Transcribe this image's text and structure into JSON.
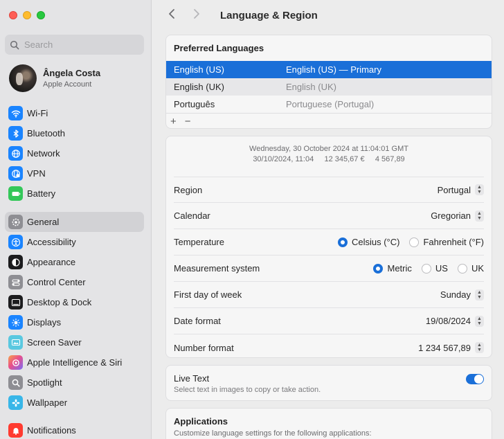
{
  "window": {
    "title": "Language & Region"
  },
  "sidebar": {
    "search_placeholder": "Search",
    "account": {
      "name": "Ângela Costa",
      "subtitle": "Apple Account"
    },
    "group1": [
      {
        "label": "Wi-Fi",
        "icon": "wifi-icon",
        "color": "#1a84ff"
      },
      {
        "label": "Bluetooth",
        "icon": "bluetooth-icon",
        "color": "#1a84ff"
      },
      {
        "label": "Network",
        "icon": "globe-icon",
        "color": "#1a84ff"
      },
      {
        "label": "VPN",
        "icon": "vpn-icon",
        "color": "#1a84ff"
      },
      {
        "label": "Battery",
        "icon": "battery-icon",
        "color": "#33c759"
      }
    ],
    "group2": [
      {
        "label": "General",
        "icon": "gear-icon",
        "color": "#8e8e93",
        "active": true
      },
      {
        "label": "Accessibility",
        "icon": "accessibility-icon",
        "color": "#1a84ff"
      },
      {
        "label": "Appearance",
        "icon": "appearance-icon",
        "color": "#1c1c1e"
      },
      {
        "label": "Control Center",
        "icon": "control-center-icon",
        "color": "#8e8e93"
      },
      {
        "label": "Desktop & Dock",
        "icon": "dock-icon",
        "color": "#1c1c1e"
      },
      {
        "label": "Displays",
        "icon": "sun-icon",
        "color": "#1a84ff"
      },
      {
        "label": "Screen Saver",
        "icon": "screen-saver-icon",
        "color": "#5ac8e0"
      },
      {
        "label": "Apple Intelligence & Siri",
        "icon": "siri-icon",
        "color": "#c86cf0"
      },
      {
        "label": "Spotlight",
        "icon": "magnifier-icon",
        "color": "#8e8e93"
      },
      {
        "label": "Wallpaper",
        "icon": "flower-icon",
        "color": "#38b6e8"
      }
    ],
    "group3": [
      {
        "label": "Notifications",
        "icon": "bell-icon",
        "color": "#ff3b30"
      }
    ]
  },
  "preferred_languages": {
    "header": "Preferred Languages",
    "rows": [
      {
        "name": "English (US)",
        "detail": "English (US) — Primary"
      },
      {
        "name": "English (UK)",
        "detail": "English (UK)"
      },
      {
        "name": "Português",
        "detail": "Portuguese (Portugal)"
      }
    ],
    "add_label": "+",
    "remove_label": "−"
  },
  "format_preview": {
    "line1": "Wednesday, 30 October 2024 at 11:04:01 GMT",
    "line2": "30/10/2024, 11:04     12 345,67 €     4 567,89"
  },
  "settings": {
    "region": {
      "label": "Region",
      "value": "Portugal"
    },
    "calendar": {
      "label": "Calendar",
      "value": "Gregorian"
    },
    "temperature": {
      "label": "Temperature",
      "options": [
        "Celsius (°C)",
        "Fahrenheit (°F)"
      ],
      "selected": "Celsius (°C)"
    },
    "measurement": {
      "label": "Measurement system",
      "options": [
        "Metric",
        "US",
        "UK"
      ],
      "selected": "Metric"
    },
    "first_day": {
      "label": "First day of week",
      "value": "Sunday"
    },
    "date_format": {
      "label": "Date format",
      "value": "19/08/2024"
    },
    "number_format": {
      "label": "Number format",
      "value": "1 234 567,89"
    }
  },
  "live_text": {
    "title": "Live Text",
    "subtitle": "Select text in images to copy or take action.",
    "enabled": true
  },
  "applications": {
    "title": "Applications",
    "subtitle": "Customize language settings for the following applications:"
  },
  "colors": {
    "accent": "#1a6fd8"
  }
}
